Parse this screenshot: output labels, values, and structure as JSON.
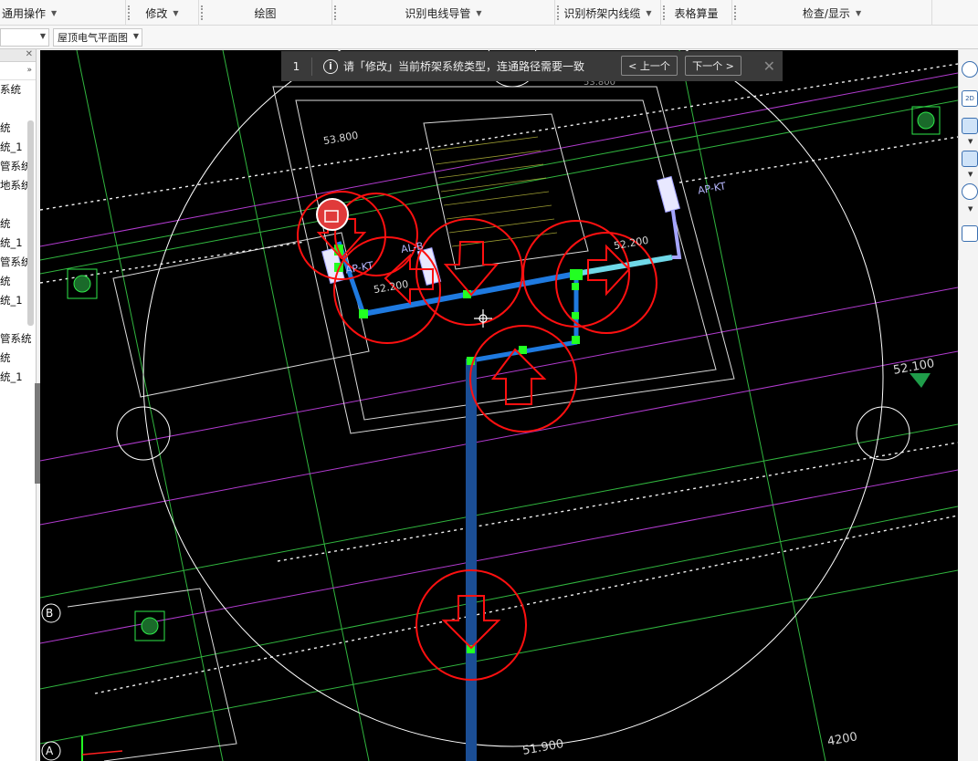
{
  "ribbon": {
    "groups": [
      {
        "label": "通用操作",
        "has_menu": true
      },
      {
        "label": "修改",
        "has_menu": true
      },
      {
        "label": "绘图",
        "has_menu": false
      },
      {
        "label": "识别电线导管",
        "has_menu": true
      },
      {
        "label": "识别桥架内线缆",
        "has_menu": true
      },
      {
        "label": "表格算量",
        "has_menu": false
      },
      {
        "label": "检查/显示",
        "has_menu": true
      }
    ]
  },
  "toolbar2": {
    "floor_combo_value": "",
    "drawing_combo_value": "屋顶电气平面图"
  },
  "left_panel": {
    "items": [
      "系统",
      "",
      "统",
      "统_1",
      "管系统",
      "地系统",
      "",
      "统",
      "统_1",
      "管系统",
      "统",
      "统_1",
      "",
      "管系统",
      "统",
      "统_1"
    ]
  },
  "message": {
    "count": "1",
    "text": "请「修改」当前桥架系统类型，连通路径需要一致",
    "prev_label": "上一个",
    "next_label": "下一个"
  },
  "cad": {
    "elevations": [
      "53.800",
      "52.200",
      "52.200",
      "52.100",
      "51.900"
    ],
    "top_partial_elev": "53.800",
    "dimension": "4200",
    "labels": [
      "AP-KT",
      "AP-KT",
      "AL-B",
      "AP-KT"
    ],
    "axis_labels": [
      "B",
      "A"
    ],
    "colors": {
      "tray_blue": "#1f7ae0",
      "tray_cyan": "#6fd8e8",
      "tray_dark": "#1b4e95",
      "error_red": "#ff1010",
      "node_green": "#22ff22"
    }
  },
  "right_toolbar": {
    "icons": [
      "orbit-icon",
      "2d-view-icon",
      "box-view-icon",
      "box-view-icon",
      "rotate-icon",
      "layer-list-icon"
    ],
    "label_2d": "2D"
  }
}
